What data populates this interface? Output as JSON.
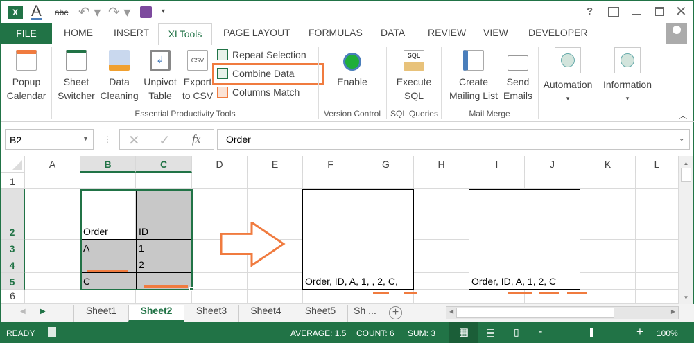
{
  "qat": {
    "title_controls": {
      "help": "?"
    }
  },
  "tabs": [
    "FILE",
    "HOME",
    "INSERT",
    "XLTools",
    "PAGE LAYOUT",
    "FORMULAS",
    "DATA",
    "REVIEW",
    "VIEW",
    "DEVELOPER"
  ],
  "ribbon": {
    "popup_calendar": [
      "Popup",
      "Calendar"
    ],
    "sheet_switcher": [
      "Sheet",
      "Switcher"
    ],
    "data_cleaning": [
      "Data",
      "Cleaning"
    ],
    "unpivot": [
      "Unpivot",
      "Table"
    ],
    "export_csv": [
      "Export",
      "to CSV"
    ],
    "repeat_selection": "Repeat Selection",
    "combine_data": "Combine Data",
    "columns_match": "Columns Match",
    "group1": "Essential Productivity Tools",
    "enable": "Enable",
    "group2": "Version Control",
    "execute_sql": [
      "Execute",
      "SQL"
    ],
    "group3": "SQL Queries",
    "create_mailing": [
      "Create",
      "Mailing List"
    ],
    "send_emails": [
      "Send",
      "Emails"
    ],
    "group4": "Mail Merge",
    "automation": "Automation",
    "information": "Information",
    "csv_icon_text": "CSV",
    "sql_icon_text": "SQL"
  },
  "formula_bar": {
    "name_box": "B2",
    "fx": "fx",
    "value": "Order"
  },
  "columns": [
    "A",
    "B",
    "C",
    "D",
    "E",
    "F",
    "G",
    "H",
    "I",
    "J",
    "K",
    "L"
  ],
  "rows": [
    "1",
    "2",
    "3",
    "4",
    "5",
    "6"
  ],
  "cells": {
    "B2": "Order",
    "C2": "ID",
    "B3": "A",
    "C3": "1",
    "C4": "2",
    "B5": "C",
    "F5": "Order, ID, A, 1, , 2, C,",
    "I5": "Order, ID, A, 1, 2, C"
  },
  "sheets": [
    "Sheet1",
    "Sheet2",
    "Sheet3",
    "Sheet4",
    "Sheet5",
    "Sh ..."
  ],
  "status": {
    "ready": "READY",
    "average": "AVERAGE: 1.5",
    "count": "COUNT: 6",
    "sum": "SUM: 3",
    "zoom": "100%"
  },
  "colors": {
    "excel_green": "#217346",
    "accent_orange": "#f07b3f"
  }
}
